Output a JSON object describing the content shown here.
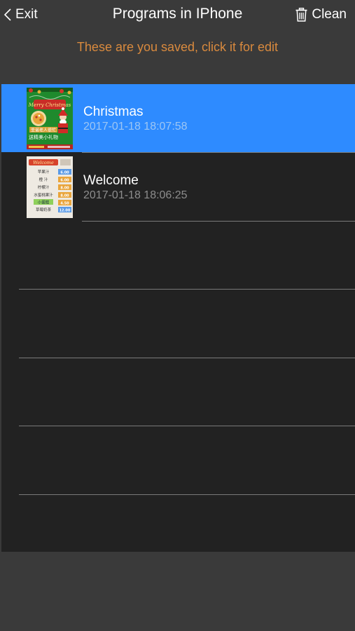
{
  "nav": {
    "back_label": "Exit",
    "title": "Programs in IPhone",
    "clean_label": "Clean",
    "back_icon": "chevron-left-icon",
    "clean_icon": "trash-icon"
  },
  "subtitle": "These are you saved, click it for edit",
  "programs": [
    {
      "title": "Christmas",
      "date": "2017-01-18 18:07:58",
      "selected": true,
      "thumb": {
        "banner": "Merry Christmas",
        "caption1": "圣诞老人很忙",
        "caption2": "送精美小礼物"
      }
    },
    {
      "title": "Welcome",
      "date": "2017-01-18 18:06:25",
      "selected": false,
      "thumb": {
        "banner": "Welcome",
        "menu": [
          {
            "name": "苹果汁",
            "price": "6.00"
          },
          {
            "name": "橙 汁",
            "price": "6.00"
          },
          {
            "name": "柠檬汁",
            "price": "8.00"
          },
          {
            "name": "水蜜桃果汁",
            "price": "8.00"
          },
          {
            "name": "小蛋糕",
            "price": "4.50"
          },
          {
            "name": "草莓奶茶",
            "price": "12.00"
          }
        ]
      }
    }
  ],
  "colors": {
    "accent": "#2e8bff",
    "subtitle": "#d98a3e",
    "background": "#3a3a3a",
    "list_background": "#222222"
  }
}
